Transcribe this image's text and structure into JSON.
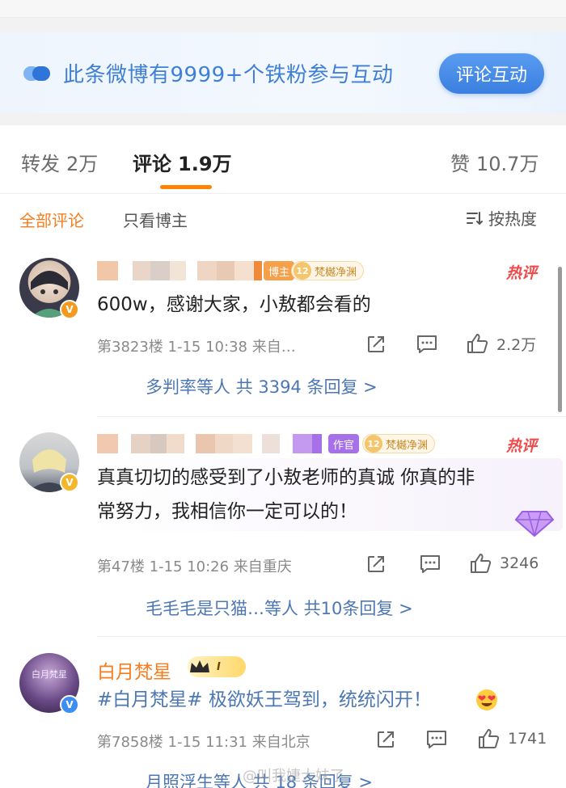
{
  "banner": {
    "fan_text": "此条微博有9999+个铁粉参与互动",
    "button_label": "评论互动"
  },
  "tabs": {
    "repost_label": "转发",
    "repost_count": "2万",
    "comment_label": "评论",
    "comment_count": "1.9万",
    "like_label": "赞",
    "like_count": "10.7万"
  },
  "filter": {
    "all": "全部评论",
    "host_only": "只看博主",
    "sort": "按热度"
  },
  "comments": [
    {
      "role_tag": "博主",
      "fan_level": "12",
      "fan_group": "梵樾净渊",
      "hot": "热评",
      "text": "600w，感谢大家，小敖都会看的",
      "meta": "第3823楼 1-15 10:38 来自…",
      "likes": "2.2万",
      "replies": "多判率等人 共 3394 条回复 >"
    },
    {
      "role_tag": "作官",
      "fan_level": "12",
      "fan_group": "梵樾净渊",
      "hot": "热评",
      "text_line1": "真真切切的感受到了小敖老师的真诚 你真的非",
      "text_line2": "常努力，我相信你一定可以的！",
      "meta": "第47楼 1-15 10:26 来自重庆",
      "likes": "3246",
      "replies": "毛毛毛是只猫…等人 共10条回复 >"
    },
    {
      "username": "白月梵星",
      "badge_level": "I",
      "avatar_text": "白月梵星",
      "text": "#白月梵星# 极欲妖王驾到，统统闪开！",
      "meta": "第7858楼 1-15 11:31 来自北京",
      "likes": "1741",
      "replies": "月照浮生等人 共 18 条回复 >"
    }
  ],
  "watermark": "@叫我婕大妹了",
  "colors": {
    "accent_orange": "#ff8200",
    "link_blue": "#4c77b3",
    "hot_red": "#f04a4a",
    "button_blue": "#3a7fe0"
  }
}
